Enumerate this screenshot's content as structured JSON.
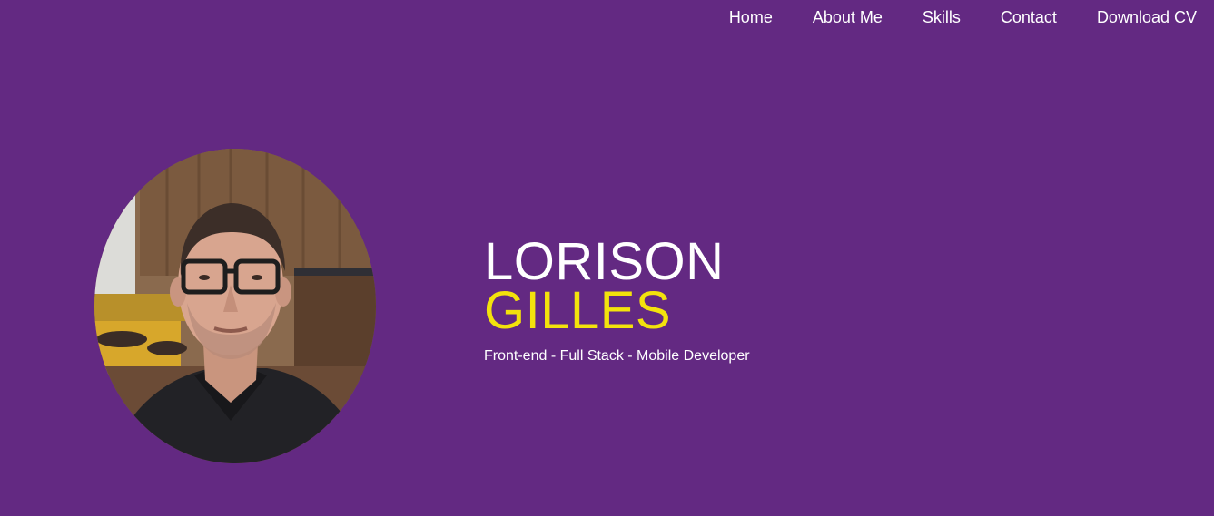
{
  "nav": {
    "items": [
      {
        "label": "Home"
      },
      {
        "label": "About Me"
      },
      {
        "label": "Skills"
      },
      {
        "label": "Contact"
      },
      {
        "label": "Download CV"
      }
    ]
  },
  "hero": {
    "first_name": "LORISON",
    "last_name": "GILLES",
    "tagline": "Front-end - Full Stack - Mobile Developer",
    "avatar_icon": "profile-photo"
  },
  "colors": {
    "background": "#632982",
    "accent": "#f3e20c",
    "text": "#ffffff"
  }
}
